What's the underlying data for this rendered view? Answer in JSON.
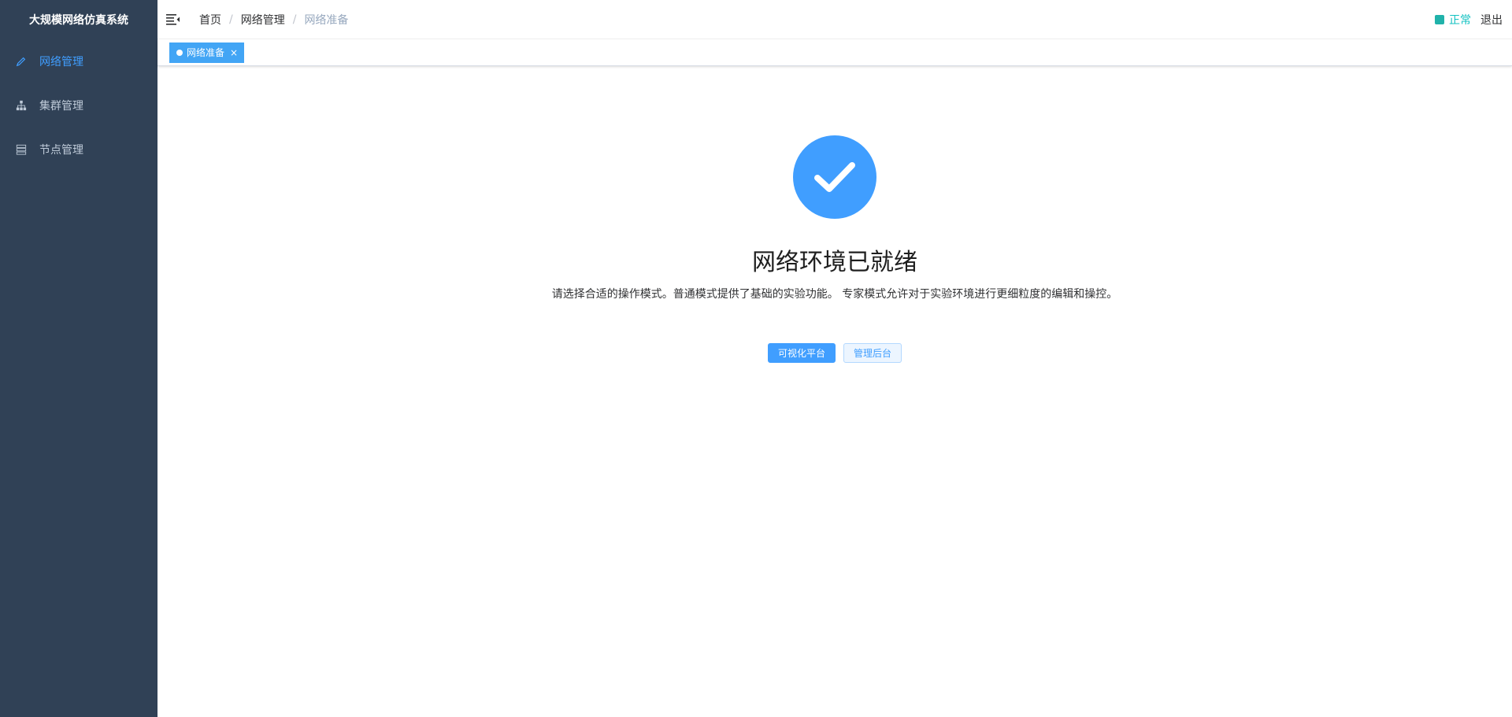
{
  "sidebar": {
    "title": "大规模网络仿真系统",
    "items": [
      {
        "label": "网络管理",
        "icon": "pencil-icon",
        "active": true
      },
      {
        "label": "集群管理",
        "icon": "tree-icon",
        "active": false
      },
      {
        "label": "节点管理",
        "icon": "server-icon",
        "active": false
      }
    ]
  },
  "navbar": {
    "breadcrumb": [
      "首页",
      "网络管理",
      "网络准备"
    ],
    "separator": "/",
    "status": "正常",
    "logout": "退出"
  },
  "tags": [
    {
      "label": "网络准备",
      "close": "×"
    }
  ],
  "result": {
    "title": "网络环境已就绪",
    "subtitle": "请选择合适的操作模式。普通模式提供了基础的实验功能。 专家模式允许对于实验环境进行更细粒度的编辑和操控。",
    "primary_button": "可视化平台",
    "secondary_button": "管理后台"
  },
  "colors": {
    "sidebar_bg": "#304156",
    "accent": "#409eff",
    "status": "#13c2c2"
  }
}
